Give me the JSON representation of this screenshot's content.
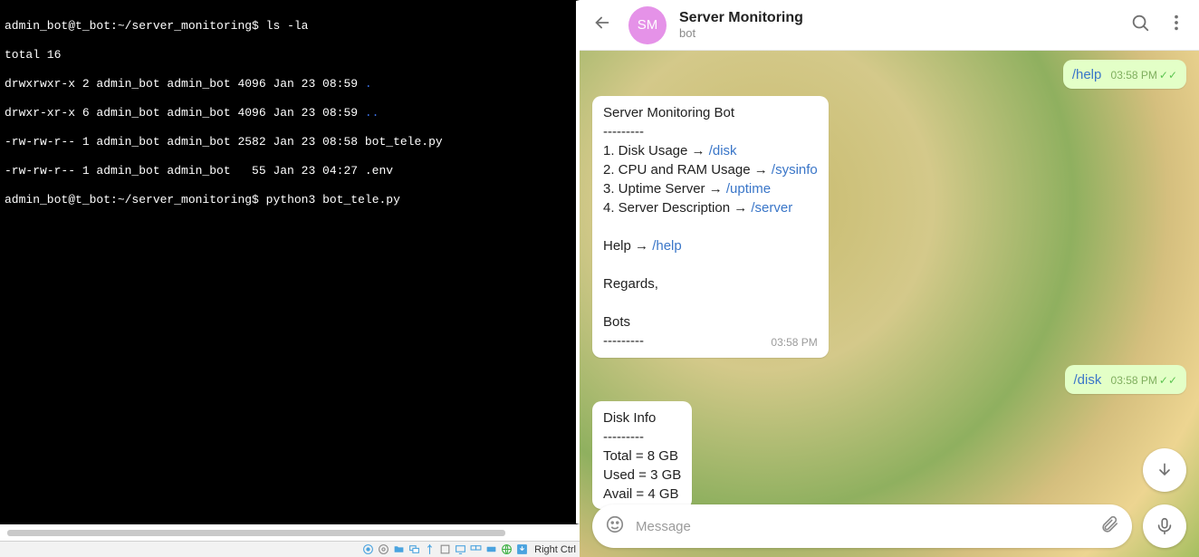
{
  "terminal": {
    "prompt_base": "admin_bot@t_bot:~/server_monitoring$",
    "cmd1": "ls -la",
    "out_total": "total 16",
    "out_l1": "drwxrwxr-x 2 admin_bot admin_bot 4096 Jan 23 08:59 ",
    "out_l1_dots": ".",
    "out_l2": "drwxr-xr-x 6 admin_bot admin_bot 4096 Jan 23 08:59 ",
    "out_l2_dots": "..",
    "out_l3": "-rw-rw-r-- 1 admin_bot admin_bot 2582 Jan 23 08:58 bot_tele.py",
    "out_l4": "-rw-rw-r-- 1 admin_bot admin_bot   55 Jan 23 04:27 .env",
    "cmd2": "python3 bot_tele.py"
  },
  "statusbar": {
    "label": "Right Ctrl"
  },
  "chat": {
    "avatar_initials": "SM",
    "title": "Server Monitoring",
    "subtitle": "bot",
    "composer_placeholder": "Message"
  },
  "msg_out1": {
    "cmd": "/help",
    "time": "03:58 PM"
  },
  "msg_in1": {
    "title": "Server Monitoring Bot",
    "sep": "---------",
    "l1a": "1. Disk Usage → ",
    "l1b": "/disk",
    "l2a": "2. CPU and RAM Usage → ",
    "l2b": "/sysinfo",
    "l3a": "3. Uptime Server → ",
    "l3b": "/uptime",
    "l4a": "4. Server Description → ",
    "l4b": "/server",
    "helpa": "Help → ",
    "helpb": "/help",
    "regards": "Regards,",
    "bots": "Bots",
    "sep2": "---------",
    "time": "03:58 PM"
  },
  "msg_out2": {
    "cmd": "/disk",
    "time": "03:58 PM"
  },
  "msg_in2": {
    "title": "Disk Info",
    "sep": "---------",
    "l1": "Total = 8 GB",
    "l2": "Used = 3 GB",
    "l3": "Avail = 4 GB"
  },
  "icons": {
    "disc": "◉",
    "globe": "◎",
    "folder": "🗀",
    "screens": "🖵",
    "usb": "⌁",
    "share": "⌂",
    "monitor": "▭",
    "monitors": "▣",
    "keycap": "⌨",
    "net": "🌐",
    "arrow": "⬇"
  }
}
